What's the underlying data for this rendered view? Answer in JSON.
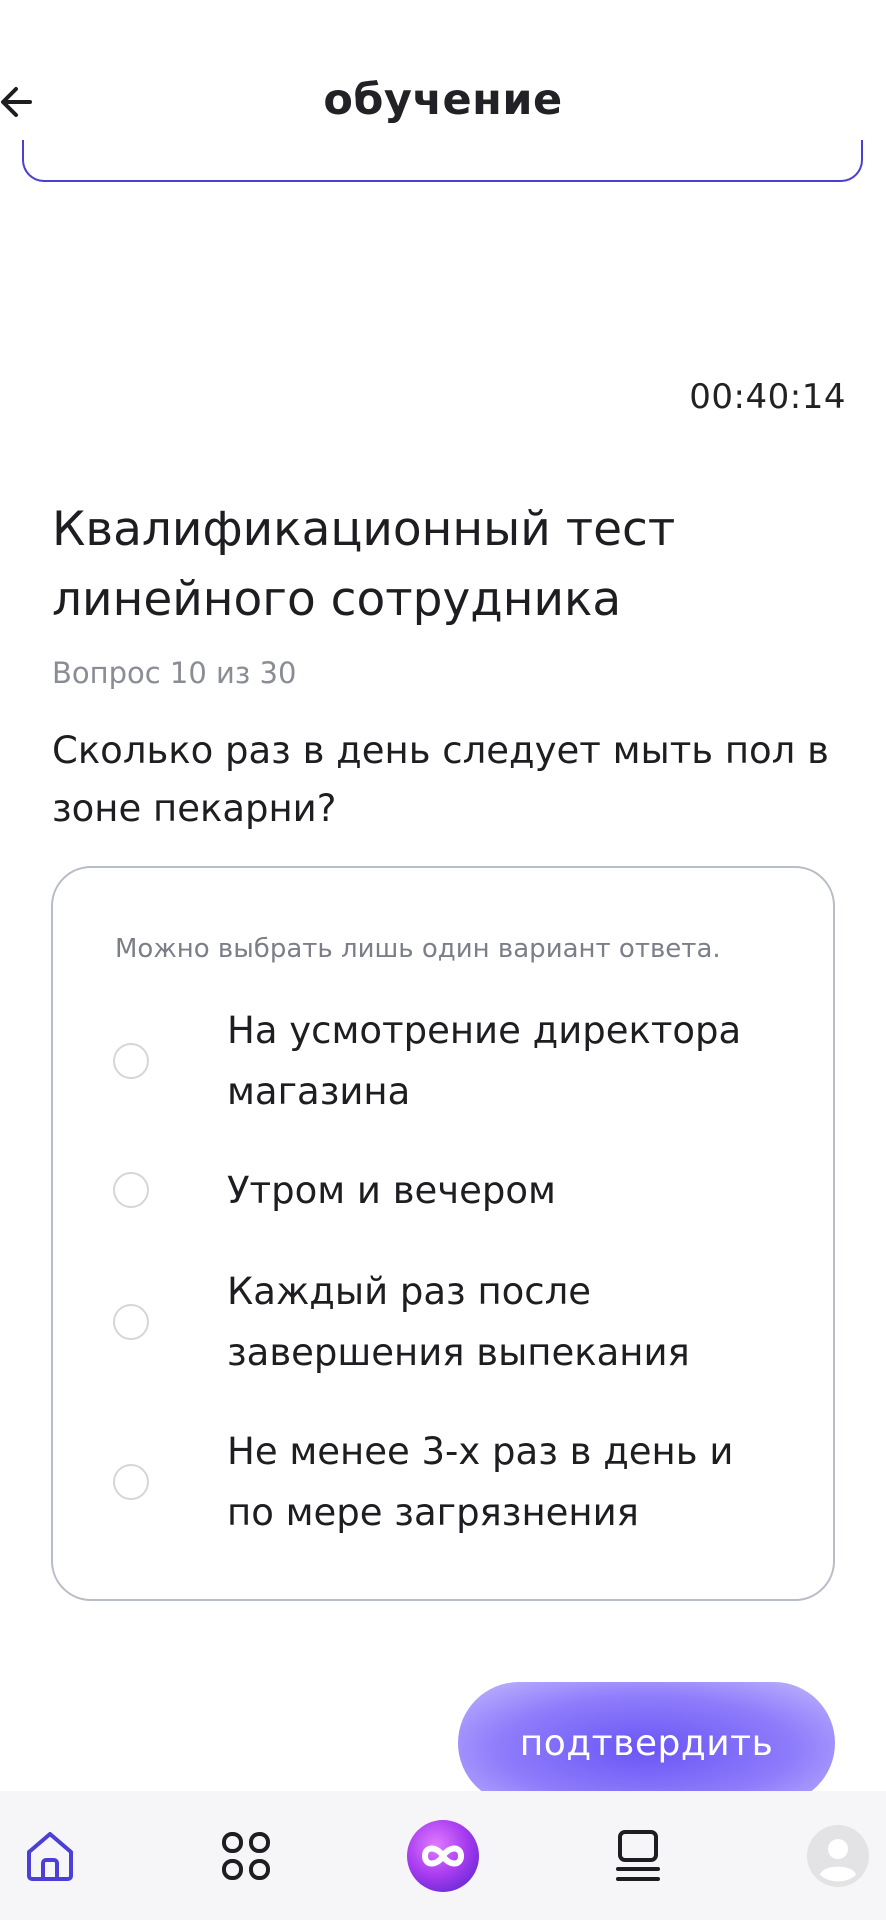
{
  "header": {
    "title": "обучение",
    "back_icon": "arrow-left-icon"
  },
  "timer": "00:40:14",
  "test": {
    "title": "Квалификационный тест линейного сотрудника",
    "counter": "Вопрос 10 из 30",
    "question": "Сколько раз в день следует мыть пол в зоне пекарни?"
  },
  "answers": {
    "hint": "Можно выбрать лишь один вариант ответа.",
    "options": [
      {
        "label": "На усмотрение директора магазина",
        "selected": false
      },
      {
        "label": "Утром и вечером",
        "selected": false
      },
      {
        "label": "Каждый раз после завершения выпекания",
        "selected": false
      },
      {
        "label": "Не менее 3-х раз в день и по мере загрязнения",
        "selected": false
      }
    ]
  },
  "confirm_button": {
    "label": "подтвердить"
  },
  "bottom_nav": {
    "items": [
      {
        "icon": "home-icon",
        "active": true
      },
      {
        "icon": "grid-icon",
        "active": false
      },
      {
        "icon": "infinity-icon",
        "active": false
      },
      {
        "icon": "courses-icon",
        "active": false
      },
      {
        "icon": "profile-avatar-icon",
        "active": false
      }
    ]
  },
  "colors": {
    "accent": "#4b3fd6",
    "button_purple": "#6a55f5",
    "muted_text": "#8a8d96",
    "card_border": "#b8bcc6"
  }
}
